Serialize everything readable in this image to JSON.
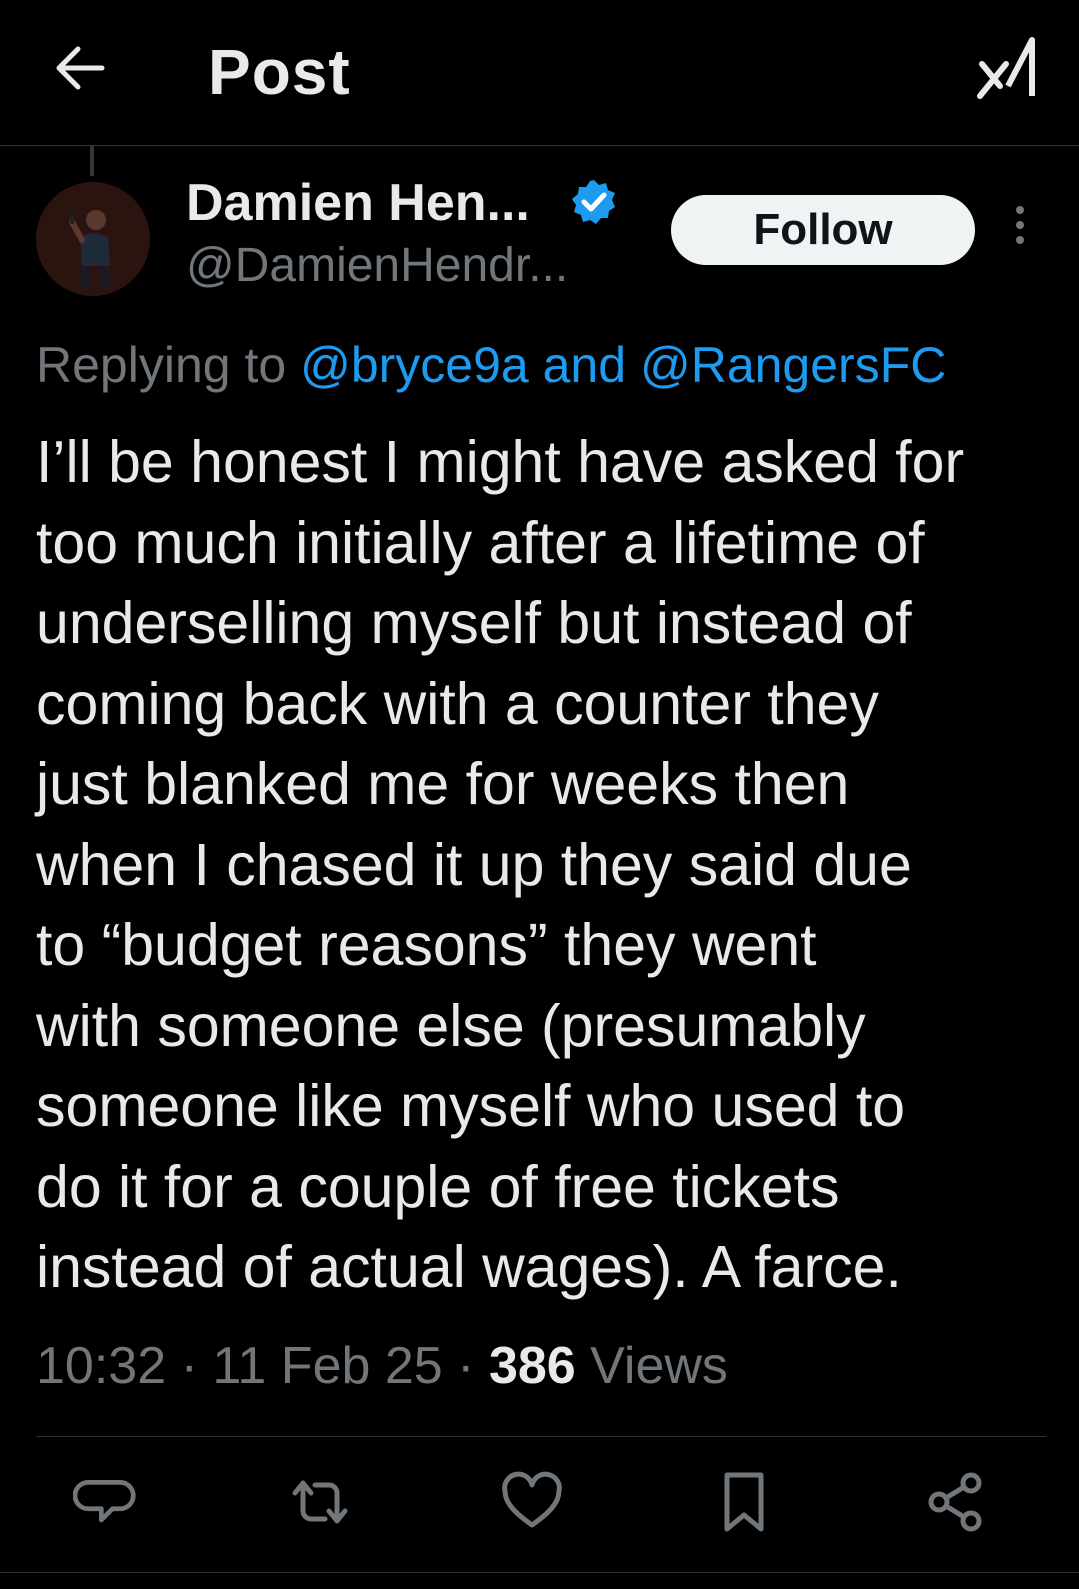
{
  "header": {
    "title": "Post",
    "back_icon": "arrow-left-icon",
    "grok_icon": "grok-icon"
  },
  "post": {
    "author": {
      "display_name": "Damien Hen...",
      "handle": "@DamienHendr...",
      "verified": true
    },
    "follow_label": "Follow",
    "reply_prefix": "Replying to",
    "reply_mention_1": "@bryce9a",
    "reply_and": "and",
    "reply_mention_2": "@RangersFC",
    "text_lines": [
      "I’ll be honest I might have asked for",
      "too much initially after a lifetime of",
      "underselling myself but instead of",
      "coming back with a counter they",
      "just blanked me for weeks then",
      "when I chased it up they said due",
      "to “budget reasons” they went",
      "with someone else (presumably",
      "someone like myself who used to",
      "do it for a couple of free tickets",
      "instead of actual wages). A farce."
    ],
    "time": "10:32",
    "date": "11 Feb 25",
    "separator": "·",
    "views_count": "386",
    "views_label": "Views"
  },
  "colors": {
    "background": "#000000",
    "text": "#e7e9ea",
    "muted": "#71767b",
    "accent": "#1d9bf0",
    "border": "#2f3336"
  },
  "actions": [
    {
      "name": "reply",
      "icon": "reply-icon"
    },
    {
      "name": "repost",
      "icon": "repost-icon"
    },
    {
      "name": "like",
      "icon": "heart-icon"
    },
    {
      "name": "bookmark",
      "icon": "bookmark-icon"
    },
    {
      "name": "share",
      "icon": "share-icon"
    }
  ]
}
